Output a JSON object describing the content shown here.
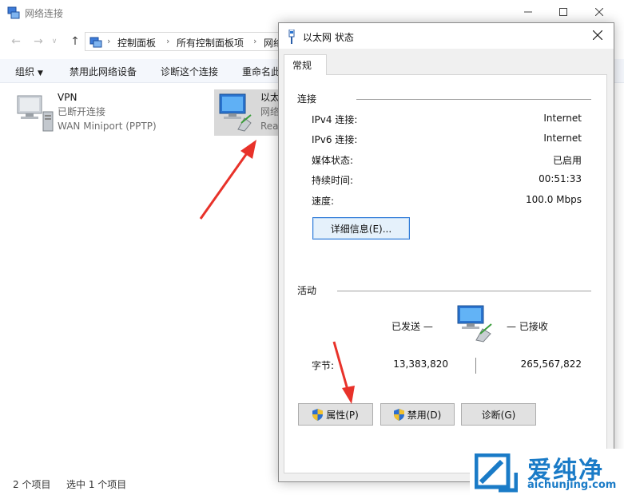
{
  "explorer": {
    "title": "网络连接",
    "breadcrumbs": [
      "控制面板",
      "所有控制面板项",
      "网络"
    ],
    "commands": [
      "组织",
      "禁用此网络设备",
      "诊断这个连接",
      "重命名此"
    ],
    "items": [
      {
        "name": "VPN",
        "status": "已断开连接",
        "device": "WAN Miniport (PPTP)"
      },
      {
        "name": "以太",
        "status": "网络",
        "device": "Rea"
      }
    ],
    "status": {
      "count": "2 个项目",
      "selected": "选中 1 个项目"
    }
  },
  "dialog": {
    "title": "以太网 状态",
    "tab": "常规",
    "connection": {
      "label": "连接",
      "rows": [
        {
          "label": "IPv4 连接:",
          "value": "Internet"
        },
        {
          "label": "IPv6 连接:",
          "value": "Internet"
        },
        {
          "label": "媒体状态:",
          "value": "已启用"
        },
        {
          "label": "持续时间:",
          "value": "00:51:33"
        },
        {
          "label": "速度:",
          "value": "100.0 Mbps"
        }
      ],
      "details_button": "详细信息(E)..."
    },
    "activity": {
      "label": "活动",
      "sent_label": "已发送 —",
      "received_label": "— 已接收",
      "bytes_label": "字节:",
      "bytes_sent": "13,383,820",
      "bytes_received": "265,567,822"
    },
    "buttons": {
      "properties": "属性(P)",
      "disable": "禁用(D)",
      "diagnose": "诊断(G)"
    }
  },
  "watermark": {
    "text": "爱纯净",
    "url": "aichunjing.com"
  },
  "colors": {
    "annotation_arrow": "#e8322a",
    "watermark": "#1a7bc7",
    "focus_border": "#2f7bd8"
  }
}
